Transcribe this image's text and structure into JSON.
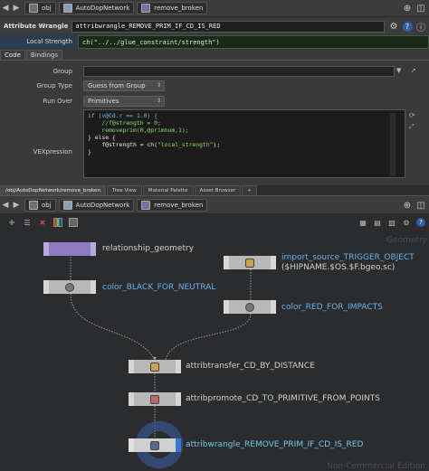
{
  "top_toolbar": {
    "obj": "obj",
    "network": "AutoDopNetwork",
    "node": "remove_broken"
  },
  "node_header": {
    "type": "Attribute Wrangle",
    "name": "attribwrangle_REMOVE_PRIM_IF_CD_IS_RED"
  },
  "local_strength": {
    "label": "Local Strength",
    "value": "ch(\"../../glue_constraint/strength\")"
  },
  "param_tabs": [
    "Code",
    "Bindings"
  ],
  "params": {
    "group_label": "Group",
    "group_type_label": "Group Type",
    "group_type_value": "Guess from Group",
    "run_over_label": "Run Over",
    "run_over_value": "Primitives",
    "vex_label": "VEXpression"
  },
  "code": {
    "line1": "if (v@Cd.r == 1.0) {",
    "line2": "    //f@strength = 0;",
    "line3": "    removeprim(0,@primnum,1);",
    "line4": "} else {",
    "line5a": "    f@strength = ch(",
    "line5b": "\"local_strength\"",
    "line5c": ");",
    "line6": "}"
  },
  "pane_tabs": [
    "/obj/AutoDopNetwork/remove_broken",
    "Tree View",
    "Material Palette",
    "Asset Browser"
  ],
  "net_toolbar": {
    "obj": "obj",
    "network": "AutoDopNetwork",
    "node": "remove_broken"
  },
  "watermarks": {
    "context": "Geometry",
    "edition": "Non-Commercial Edition"
  },
  "nodes": {
    "relationship_geometry": "relationship_geometry",
    "import_source_label": "import_source_TRIGGER_OBJECT",
    "import_source_sub": "($HIPNAME.$OS.$F.bgeo.sc)",
    "color_black": "color_BLACK_FOR_NEUTRAL",
    "color_red": "color_RED_FOR_IMPACTS",
    "attribtransfer": "attribtransfer_CD_BY_DISTANCE",
    "attribpromote": "attribpromote_CD_TO_PRIMITIVE_FROM_POINTS",
    "attribwrangle": "attribwrangle_REMOVE_PRIM_IF_CD_IS_RED"
  },
  "colors": {
    "accent_blue": "#6ab0e8",
    "halo": "#3a5ea8",
    "local_strength_bg": "#1a2a1a"
  }
}
